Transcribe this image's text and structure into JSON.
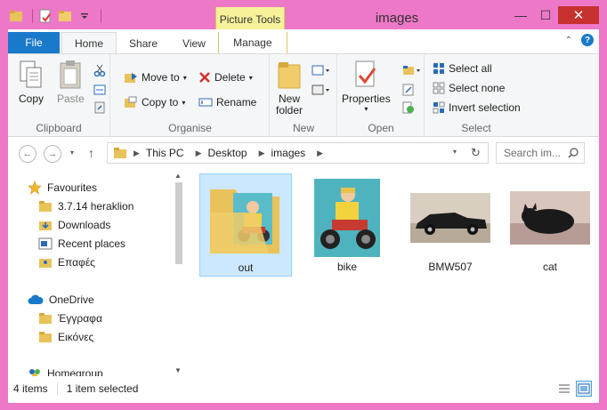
{
  "window": {
    "title": "images",
    "context_tab_group": "Picture Tools",
    "controls": {
      "minimize": "—",
      "maximize": "☐",
      "close": "✕"
    }
  },
  "ribbon": {
    "tabs": [
      {
        "label": "File"
      },
      {
        "label": "Home"
      },
      {
        "label": "Share"
      },
      {
        "label": "View"
      },
      {
        "label": "Manage"
      }
    ],
    "clipboard": {
      "copy": "Copy",
      "paste": "Paste",
      "label": "Clipboard"
    },
    "organise": {
      "move_to": "Move to",
      "copy_to": "Copy to",
      "delete": "Delete",
      "rename": "Rename",
      "label": "Organise"
    },
    "new": {
      "new_folder_line1": "New",
      "new_folder_line2": "folder",
      "label": "New"
    },
    "open": {
      "properties": "Properties",
      "label": "Open"
    },
    "select": {
      "select_all": "Select all",
      "select_none": "Select none",
      "invert_selection": "Invert selection",
      "label": "Select"
    }
  },
  "address": {
    "breadcrumbs": [
      "This PC",
      "Desktop",
      "images"
    ],
    "search_placeholder": "Search im..."
  },
  "nav_pane": {
    "favourites": "Favourites",
    "favourite_items": [
      "3.7.14 heraklion",
      "Downloads",
      "Recent places",
      "Επαφές"
    ],
    "onedrive": "OneDrive",
    "onedrive_items": [
      "Έγγραφα",
      "Εικόνες"
    ],
    "homegroup": "Homegroup"
  },
  "files": [
    {
      "name": "out",
      "kind": "folder",
      "selected": true
    },
    {
      "name": "bike",
      "kind": "image",
      "selected": false
    },
    {
      "name": "BMW507",
      "kind": "image",
      "selected": false
    },
    {
      "name": "cat",
      "kind": "image",
      "selected": false
    }
  ],
  "status": {
    "items": "4 items",
    "selected": "1 item selected"
  },
  "colors": {
    "frame": "#ee78c8",
    "file_tab": "#1979ca",
    "context_tab": "#f7f29a",
    "selection": "#cce8ff",
    "close_button": "#c7312f"
  }
}
